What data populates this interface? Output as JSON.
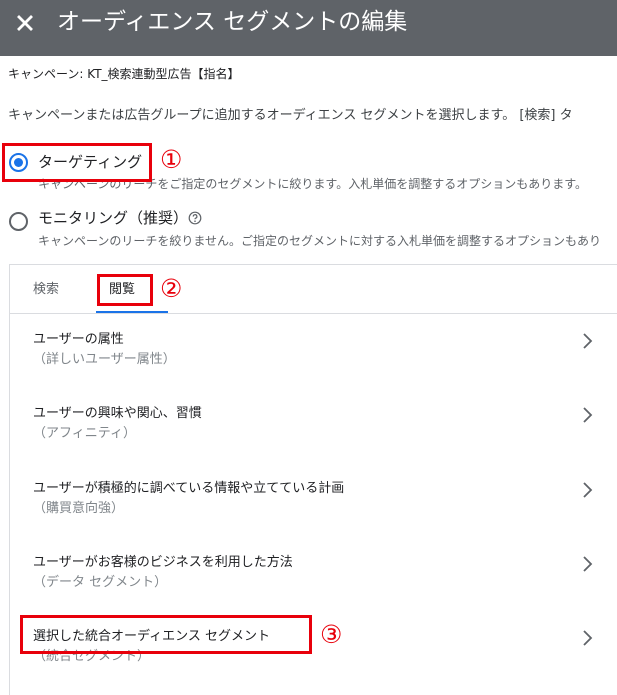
{
  "header": {
    "close_icon": "close-icon",
    "title": "オーディエンス セグメントの編集"
  },
  "campaign_label": "キャンペーン: KT_検索連動型広告【指名】",
  "intro_text": "キャンペーンまたは広告グループに追加するオーディエンス セグメントを選択します。 [検索] タ",
  "options": [
    {
      "label": "ターゲティング",
      "description": "キャンペーンのリーチをご指定のセグメントに絞ります。入札単価を調整するオプションもあります。",
      "checked": true
    },
    {
      "label": "モニタリング（推奨）",
      "description": "キャンペーンのリーチを絞りません。ご指定のセグメントに対する入札単価を調整するオプションもあり",
      "checked": false,
      "help_icon": "help-circle-icon"
    }
  ],
  "annotations": [
    "①",
    "②",
    "③"
  ],
  "tabs": [
    {
      "label": "検索",
      "active": false
    },
    {
      "label": "閲覧",
      "active": true
    }
  ],
  "browse_items": [
    {
      "title": "ユーザーの属性",
      "subtitle": "（詳しいユーザー属性）"
    },
    {
      "title": "ユーザーの興味や関心、習慣",
      "subtitle": "（アフィニティ）"
    },
    {
      "title": "ユーザーが積極的に調べている情報や立てている計画",
      "subtitle": "（購買意向強）"
    },
    {
      "title": "ユーザーがお客様のビジネスを利用した方法",
      "subtitle": "（データ セグメント）"
    },
    {
      "title": "選択した統合オーディエンス セグメント",
      "subtitle": "（統合セグメント）"
    }
  ],
  "colors": {
    "header_bg": "#5f6368",
    "accent": "#1a73e8",
    "annotation_red": "#e8000b"
  }
}
